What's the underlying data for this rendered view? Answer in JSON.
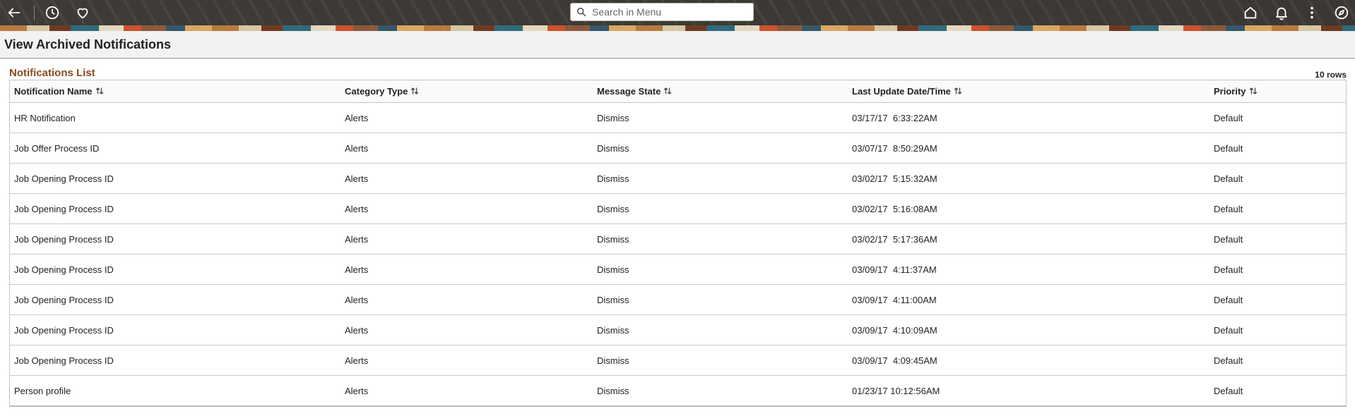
{
  "search": {
    "placeholder": "Search in Menu"
  },
  "page": {
    "title": "View Archived Notifications"
  },
  "grid": {
    "title": "Notifications List",
    "row_count": "10 rows",
    "columns": [
      "Notification Name",
      "Category Type",
      "Message State",
      "Last Update Date/Time",
      "Priority"
    ],
    "rows": [
      [
        "HR Notification",
        "Alerts",
        "Dismiss",
        "03/17/17  6:33:22AM",
        "Default"
      ],
      [
        "Job Offer Process ID",
        "Alerts",
        "Dismiss",
        "03/07/17  8:50:29AM",
        "Default"
      ],
      [
        "Job Opening Process ID",
        "Alerts",
        "Dismiss",
        "03/02/17  5:15:32AM",
        "Default"
      ],
      [
        "Job Opening Process ID",
        "Alerts",
        "Dismiss",
        "03/02/17  5:16:08AM",
        "Default"
      ],
      [
        "Job Opening Process ID",
        "Alerts",
        "Dismiss",
        "03/02/17  5:17:36AM",
        "Default"
      ],
      [
        "Job Opening Process ID",
        "Alerts",
        "Dismiss",
        "03/09/17  4:11:37AM",
        "Default"
      ],
      [
        "Job Opening Process ID",
        "Alerts",
        "Dismiss",
        "03/09/17  4:11:00AM",
        "Default"
      ],
      [
        "Job Opening Process ID",
        "Alerts",
        "Dismiss",
        "03/09/17  4:10:09AM",
        "Default"
      ],
      [
        "Job Opening Process ID",
        "Alerts",
        "Dismiss",
        "03/09/17  4:09:45AM",
        "Default"
      ],
      [
        "Person profile",
        "Alerts",
        "Dismiss",
        "01/23/17 10:12:56AM",
        "Default"
      ]
    ]
  },
  "icons": {
    "back": "back-arrow-icon",
    "recent": "clock-icon",
    "favorites": "heart-icon",
    "search": "search-icon",
    "home": "home-icon",
    "notifications": "bell-icon",
    "actions": "kebab-menu-icon",
    "navbar": "compass-icon",
    "sort": "sort-icon"
  },
  "colors": {
    "banner": "#3e3a36",
    "grid_title": "#8a4b1f",
    "header_bg": "#f2f2f2"
  }
}
